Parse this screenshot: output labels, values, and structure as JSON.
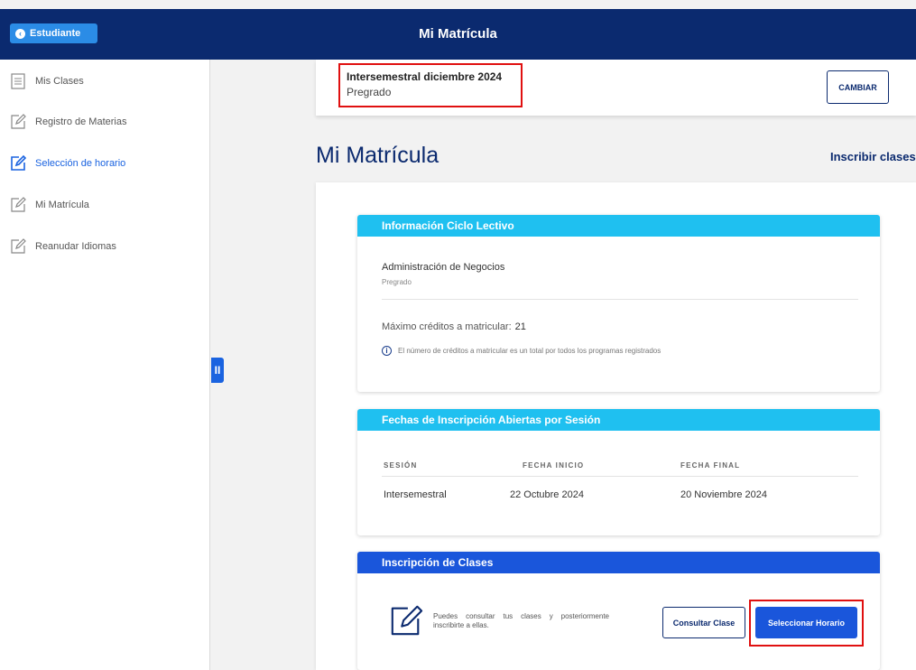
{
  "header": {
    "back_label": "Estudiante",
    "title": "Mi Matrícula"
  },
  "sidebar": {
    "items": [
      {
        "label": "Mis Clases",
        "icon": "list-icon",
        "active": false
      },
      {
        "label": "Registro de Materias",
        "icon": "edit-icon",
        "active": false
      },
      {
        "label": "Selección de horario",
        "icon": "edit-icon",
        "active": true
      },
      {
        "label": "Mi Matrícula",
        "icon": "edit-icon",
        "active": false
      },
      {
        "label": "Reanudar Idiomas",
        "icon": "edit-icon",
        "active": false
      }
    ]
  },
  "term": {
    "name": "Intersemestral diciembre 2024",
    "level": "Pregrado",
    "change_label": "CAMBIAR"
  },
  "page": {
    "title": "Mi Matrícula",
    "link": "Inscribir clases"
  },
  "ciclo": {
    "header": "Información Ciclo Lectivo",
    "program": "Administración de Negocios",
    "level": "Pregrado",
    "max_label": "Máximo créditos a matricular:",
    "max_value": "21",
    "info": "El número de créditos a matricular es un total por todos los programas registrados"
  },
  "fechas": {
    "header": "Fechas de Inscripción Abiertas por Sesión",
    "columns": [
      "SESIÓN",
      "FECHA INICIO",
      "FECHA FINAL"
    ],
    "rows": [
      [
        "Intersemestral",
        "22 Octubre 2024",
        "20 Noviembre 2024"
      ]
    ]
  },
  "inscripcion": {
    "header": "Inscripción de Clases",
    "text": "Puedes consultar tus clases y posteriormente inscribirte a ellas.",
    "consult_label": "Consultar Clase",
    "select_label": "Seleccionar Horario"
  },
  "colors": {
    "navy": "#0b2a6f",
    "accent": "#1a56db",
    "cyan": "#1fc0f0",
    "highlight": "#e01010"
  }
}
